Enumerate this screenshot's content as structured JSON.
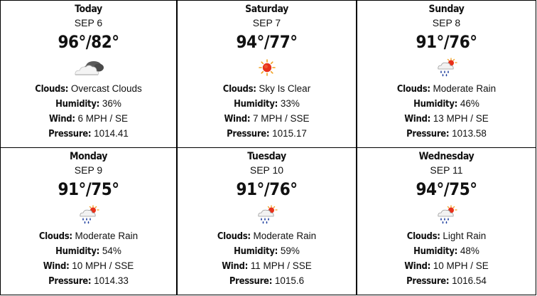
{
  "labels": {
    "clouds": "Clouds:",
    "humidity": "Humidity:",
    "wind": "Wind:",
    "pressure": "Pressure:"
  },
  "days": [
    {
      "day": "Today",
      "date": "SEP 6",
      "temp": "96°/82°",
      "icon": "overcast-cloud-icon",
      "clouds": "Overcast Clouds",
      "humidity": "36%",
      "wind": "6 MPH / SE",
      "pressure": "1014.41"
    },
    {
      "day": "Saturday",
      "date": "SEP 7",
      "temp": "94°/77°",
      "icon": "sun-icon",
      "clouds": "Sky Is Clear",
      "humidity": "33%",
      "wind": "7 MPH / SSE",
      "pressure": "1015.17"
    },
    {
      "day": "Sunday",
      "date": "SEP 8",
      "temp": "91°/76°",
      "icon": "sun-rain-cloud-icon",
      "clouds": "Moderate Rain",
      "humidity": "46%",
      "wind": "13 MPH / SE",
      "pressure": "1013.58"
    },
    {
      "day": "Monday",
      "date": "SEP 9",
      "temp": "91°/75°",
      "icon": "sun-rain-cloud-icon",
      "clouds": "Moderate Rain",
      "humidity": "54%",
      "wind": "10 MPH / SSE",
      "pressure": "1014.33"
    },
    {
      "day": "Tuesday",
      "date": "SEP 10",
      "temp": "91°/76°",
      "icon": "sun-rain-cloud-icon",
      "clouds": "Moderate Rain",
      "humidity": "59%",
      "wind": "11 MPH / SSE",
      "pressure": "1015.6"
    },
    {
      "day": "Wednesday",
      "date": "SEP 11",
      "temp": "94°/75°",
      "icon": "sun-rain-cloud-icon",
      "clouds": "Light Rain",
      "humidity": "48%",
      "wind": "10 MPH / SE",
      "pressure": "1016.54"
    }
  ],
  "colors": {
    "sun": "#e8301a",
    "sun_rays": "#f0a020",
    "cloud_light": "#f2f2f2",
    "cloud_dark": "#555555",
    "rain": "#1f3f9e",
    "border": "#000000"
  }
}
